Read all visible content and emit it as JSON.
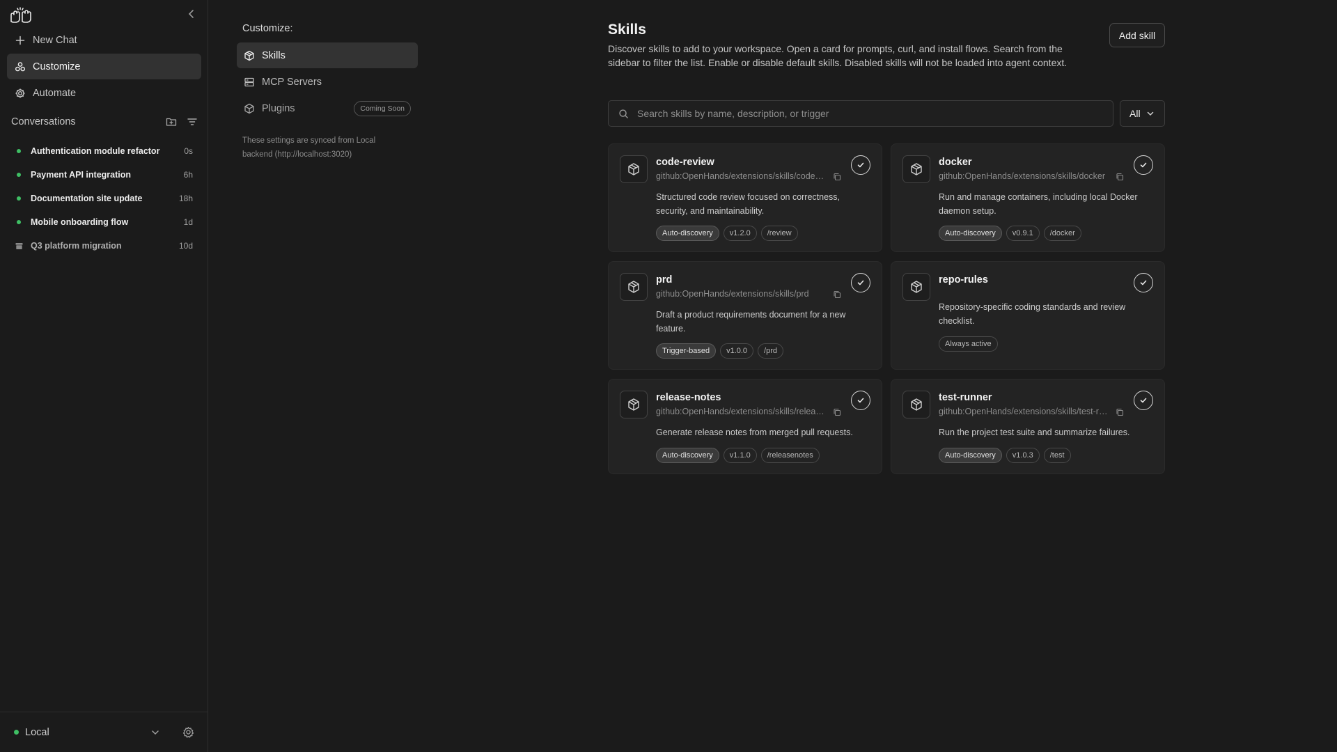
{
  "sidebar": {
    "nav": [
      {
        "label": "New Chat",
        "icon": "plus-icon"
      },
      {
        "label": "Customize",
        "icon": "customize-icon"
      },
      {
        "label": "Automate",
        "icon": "automate-icon"
      }
    ],
    "conversations_title": "Conversations",
    "conversations": [
      {
        "name": "Authentication module refactor",
        "time": "0s",
        "status": "active"
      },
      {
        "name": "Payment API integration",
        "time": "6h",
        "status": "active"
      },
      {
        "name": "Documentation site update",
        "time": "18h",
        "status": "active"
      },
      {
        "name": "Mobile onboarding flow",
        "time": "1d",
        "status": "active"
      },
      {
        "name": "Q3 platform migration",
        "time": "10d",
        "status": "archived"
      }
    ],
    "footer": {
      "environment": "Local"
    }
  },
  "settings": {
    "title": "Customize:",
    "menu": [
      {
        "label": "Skills"
      },
      {
        "label": "MCP Servers"
      },
      {
        "label": "Plugins",
        "badge": "Coming Soon"
      }
    ],
    "sync_note": "These settings are synced from Local backend (http://localhost:3020)"
  },
  "main": {
    "title": "Skills",
    "description": "Discover skills to add to your workspace. Open a card for prompts, curl, and install flows. Search from the sidebar to filter the list. Enable or disable default skills. Disabled skills will not be loaded into agent context.",
    "add_button": "Add skill",
    "search_placeholder": "Search skills by name, description, or trigger",
    "filter_value": "All"
  },
  "skills": [
    {
      "name": "code-review",
      "source": "github:OpenHands/extensions/skills/code-review",
      "description": "Structured code review focused on correctness, security, and maintainability.",
      "tags": [
        "Auto-discovery",
        "v1.2.0",
        "/review"
      ],
      "enabled": true
    },
    {
      "name": "docker",
      "source": "github:OpenHands/extensions/skills/docker",
      "description": "Run and manage containers, including local Docker daemon setup.",
      "tags": [
        "Auto-discovery",
        "v0.9.1",
        "/docker"
      ],
      "enabled": true
    },
    {
      "name": "prd",
      "source": "github:OpenHands/extensions/skills/prd",
      "description": "Draft a product requirements document for a new feature.",
      "tags": [
        "Trigger-based",
        "v1.0.0",
        "/prd"
      ],
      "enabled": true
    },
    {
      "name": "repo-rules",
      "source": "",
      "description": "Repository-specific coding standards and review checklist.",
      "tags": [
        "Always active"
      ],
      "enabled": true
    },
    {
      "name": "release-notes",
      "source": "github:OpenHands/extensions/skills/release-notes",
      "description": "Generate release notes from merged pull requests.",
      "tags": [
        "Auto-discovery",
        "v1.1.0",
        "/releasenotes"
      ],
      "enabled": true
    },
    {
      "name": "test-runner",
      "source": "github:OpenHands/extensions/skills/test-runner",
      "description": "Run the project test suite and summarize failures.",
      "tags": [
        "Auto-discovery",
        "v1.0.3",
        "/test"
      ],
      "enabled": true
    }
  ]
}
